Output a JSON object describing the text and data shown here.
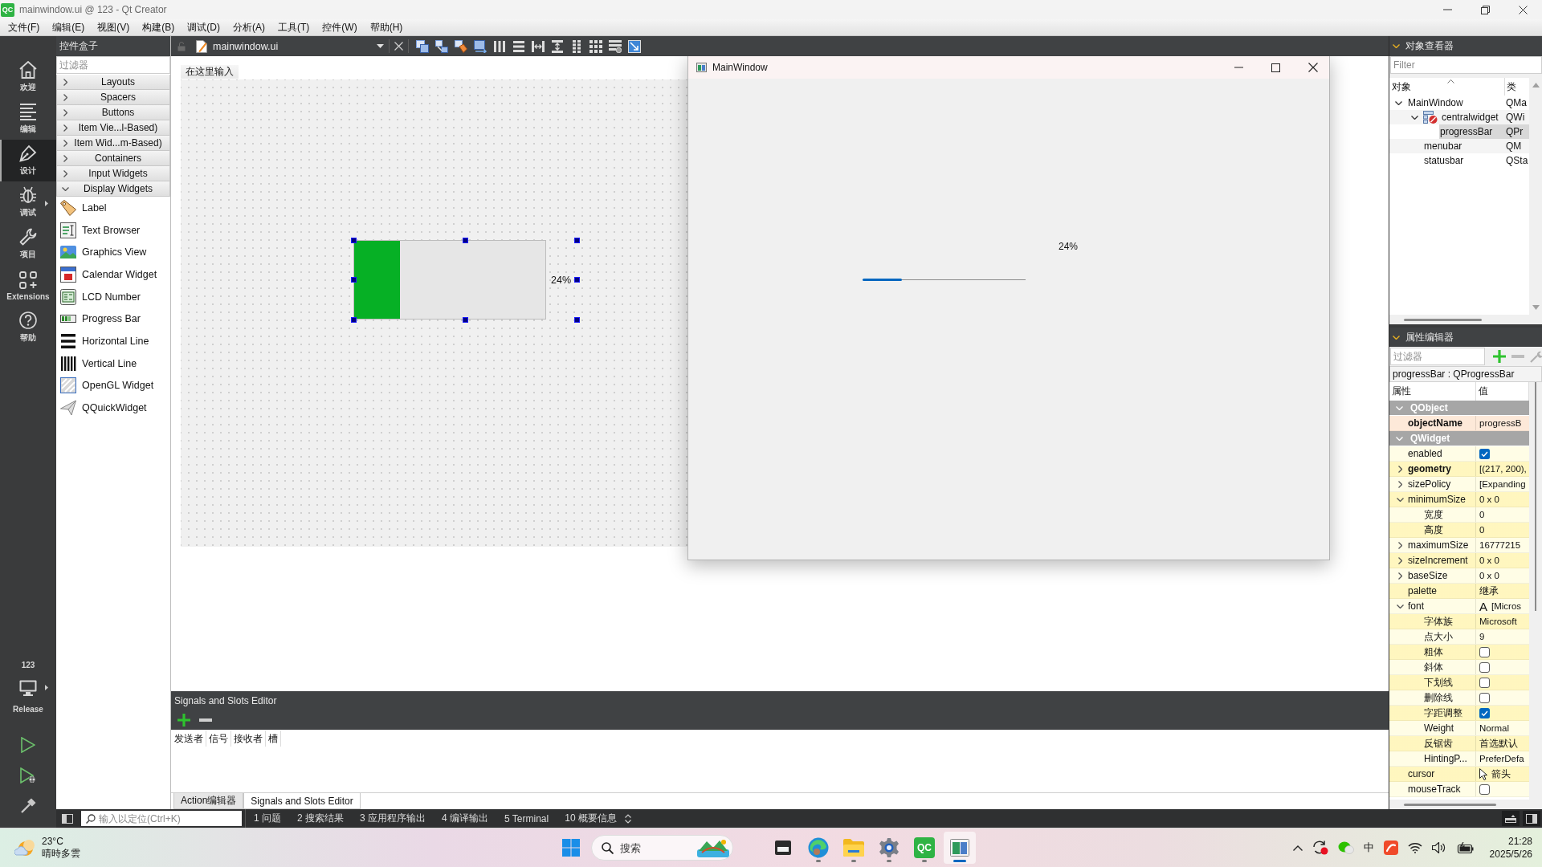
{
  "window": {
    "logo": "QC",
    "title": "mainwindow.ui @ 123 - Qt Creator"
  },
  "menu_bar": [
    "文件(F)",
    "编辑(E)",
    "视图(V)",
    "构建(B)",
    "调试(D)",
    "分析(A)",
    "工具(T)",
    "控件(W)",
    "帮助(H)"
  ],
  "mode_bar": {
    "modes": [
      {
        "label": "欢迎",
        "selected": false
      },
      {
        "label": "编辑",
        "selected": false
      },
      {
        "label": "设计",
        "selected": true
      },
      {
        "label": "调试",
        "selected": false
      },
      {
        "label": "项目",
        "selected": false
      },
      {
        "label": "Extensions",
        "selected": false
      },
      {
        "label": "帮助",
        "selected": false
      }
    ],
    "project": "123",
    "build": "Release"
  },
  "widget_box": {
    "title": "控件盒子",
    "filter": {
      "placeholder": "过滤器"
    },
    "categories": [
      {
        "label": "Layouts",
        "expanded": false
      },
      {
        "label": "Spacers",
        "expanded": false
      },
      {
        "label": "Buttons",
        "expanded": false
      },
      {
        "label": "Item Vie...l-Based)",
        "expanded": false
      },
      {
        "label": "Item Wid...m-Based)",
        "expanded": false
      },
      {
        "label": "Containers",
        "expanded": false
      },
      {
        "label": "Input Widgets",
        "expanded": false
      },
      {
        "label": "Display Widgets",
        "expanded": true,
        "items": [
          "Label",
          "Text Browser",
          "Graphics View",
          "Calendar Widget",
          "LCD Number",
          "Progress Bar",
          "Horizontal Line",
          "Vertical Line",
          "OpenGL Widget",
          "QQuickWidget"
        ]
      }
    ]
  },
  "editor": {
    "file": "mainwindow.ui",
    "form": {
      "menu_placeholder": "在这里输入",
      "progress_bar": {
        "level": 0.24,
        "text": "24%",
        "selected": true
      }
    }
  },
  "preview": {
    "title": "MainWindow",
    "progress_bar": {
      "level": 0.24,
      "text": "24%"
    }
  },
  "object_inspector": {
    "title": "对象查看器",
    "filter": {
      "placeholder": "Filter"
    },
    "columns": [
      "对象",
      "类"
    ],
    "tree": [
      {
        "object": "MainWindow",
        "class": "QMa",
        "expanded": true,
        "selected": false,
        "children": [
          {
            "object": "centralwidget",
            "class": "QWi",
            "expanded": true,
            "selected": false,
            "children": [
              {
                "object": "progressBar",
                "class": "QPr",
                "selected": true
              }
            ]
          },
          {
            "object": "menubar",
            "class": "QM",
            "selected": false
          },
          {
            "object": "statusbar",
            "class": "QSta",
            "selected": false
          }
        ]
      }
    ]
  },
  "property_editor": {
    "title": "属性编辑器",
    "filter": {
      "placeholder": "过滤器"
    },
    "object": "progressBar : QProgressBar",
    "columns": [
      "属性",
      "值"
    ],
    "groups": [
      {
        "name": "QObject",
        "expanded": true,
        "color": "#fde9d9",
        "properties": [
          {
            "name": "objectName",
            "kind": "text",
            "value": "progressB",
            "modified": true
          }
        ]
      },
      {
        "name": "QWidget",
        "expanded": true,
        "color": "#fffde6",
        "properties": [
          {
            "name": "enabled",
            "kind": "checkbox",
            "checked": true,
            "modified": false
          },
          {
            "name": "geometry",
            "kind": "text",
            "value": "[(217, 200),",
            "modified": true,
            "expanded": false
          },
          {
            "name": "sizePolicy",
            "kind": "text",
            "value": "[Expanding",
            "modified": false,
            "expanded": false
          },
          {
            "name": "minimumSize",
            "kind": "text",
            "value": "0 x 0",
            "modified": false,
            "expanded": true,
            "children": [
              {
                "name": "宽度",
                "kind": "text",
                "value": "0",
                "modified": false
              },
              {
                "name": "高度",
                "kind": "text",
                "value": "0",
                "modified": false
              }
            ]
          },
          {
            "name": "maximumSize",
            "kind": "text",
            "value": "16777215",
            "modified": false,
            "expanded": false
          },
          {
            "name": "sizeIncrement",
            "kind": "text",
            "value": "0 x 0",
            "modified": false,
            "expanded": false
          },
          {
            "name": "baseSize",
            "kind": "text",
            "value": "0 x 0",
            "modified": false,
            "expanded": false
          },
          {
            "name": "palette",
            "kind": "text",
            "value": "继承",
            "modified": false
          },
          {
            "name": "font",
            "kind": "font",
            "preview": "A",
            "value": "[Micros",
            "modified": false,
            "expanded": true,
            "children": [
              {
                "name": "字体族",
                "kind": "text",
                "value": "Microsoft",
                "modified": false
              },
              {
                "name": "点大小",
                "kind": "text",
                "value": "9",
                "modified": false
              },
              {
                "name": "粗体",
                "kind": "checkbox",
                "checked": false,
                "modified": false
              },
              {
                "name": "斜体",
                "kind": "checkbox",
                "checked": false,
                "modified": false
              },
              {
                "name": "下划线",
                "kind": "checkbox",
                "checked": false,
                "modified": false
              },
              {
                "name": "删除线",
                "kind": "checkbox",
                "checked": false,
                "modified": false
              },
              {
                "name": "字距调整",
                "kind": "checkbox",
                "checked": true,
                "modified": false
              },
              {
                "name": "Weight",
                "kind": "text",
                "value": "Normal",
                "modified": false
              },
              {
                "name": "反锯齿",
                "kind": "text",
                "value": "首选默认",
                "modified": false
              },
              {
                "name": "HintingP...",
                "kind": "text",
                "value": "PreferDefa",
                "modified": false
              }
            ]
          },
          {
            "name": "cursor",
            "kind": "cursor",
            "value": "箭头",
            "modified": false
          },
          {
            "name": "mouseTrack",
            "kind": "checkbox",
            "checked": false,
            "modified": false
          }
        ]
      }
    ]
  },
  "signals_slots": {
    "title": "Signals and Slots Editor",
    "columns": [
      "发送者",
      "信号",
      "接收者",
      "槽"
    ],
    "tabs": [
      {
        "label": "Action编辑器",
        "selected": false
      },
      {
        "label": "Signals and Slots Editor",
        "selected": true
      }
    ]
  },
  "status_bar": {
    "search": {
      "placeholder": "输入以定位(Ctrl+K)"
    },
    "panes": [
      "1 问题",
      "2 搜索结果",
      "3 应用程序输出",
      "4 编译输出",
      "5 Terminal",
      "10 概要信息"
    ]
  },
  "taskbar": {
    "weather": {
      "temperature": "23°C",
      "condition": "晴時多雲"
    },
    "search": {
      "placeholder": "搜索"
    },
    "apps": [
      {
        "running": false,
        "selected": false
      },
      {
        "running": true,
        "selected": false
      },
      {
        "running": true,
        "selected": false
      },
      {
        "running": true,
        "selected": false
      },
      {
        "label": "QC",
        "running": true,
        "selected": false
      },
      {
        "running": true,
        "selected": true
      }
    ],
    "tray": {
      "ime": "中"
    },
    "clock": {
      "time": "21:28",
      "date": "2025/5/26"
    }
  }
}
